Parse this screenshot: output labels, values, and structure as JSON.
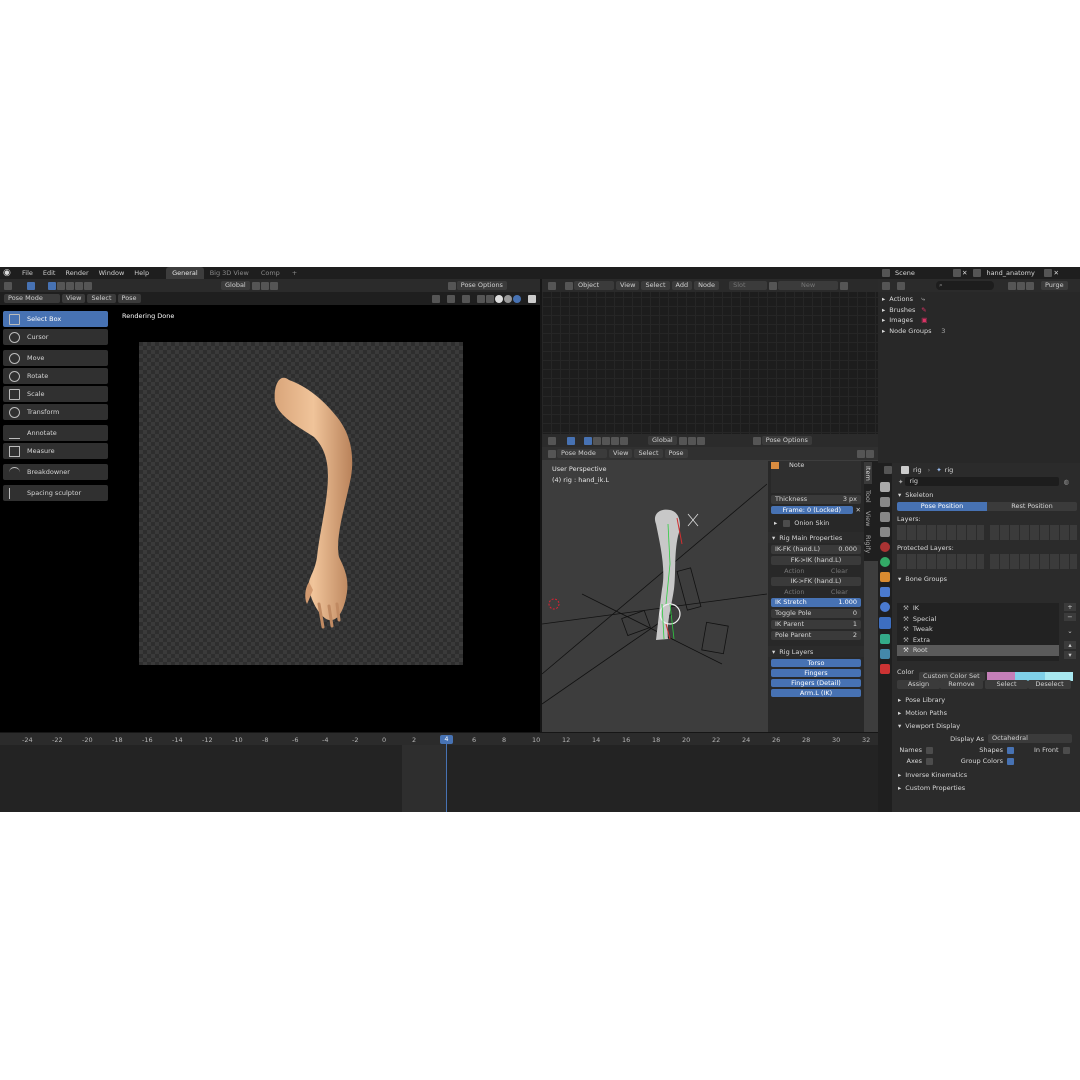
{
  "topbar": {
    "menus": [
      "File",
      "Edit",
      "Render",
      "Window",
      "Help"
    ],
    "workspaces": [
      {
        "label": "General",
        "active": true
      },
      {
        "label": "Big 3D View",
        "active": false
      },
      {
        "label": "Comp",
        "active": false
      }
    ],
    "add_tab": "+"
  },
  "left_viewport": {
    "mode": "Pose Mode",
    "menus": [
      "View",
      "Select",
      "Pose"
    ],
    "orientation": "Global",
    "pose_options": "Pose Options",
    "status": "Rendering Done",
    "tools": [
      "Select Box",
      "Cursor",
      "Move",
      "Rotate",
      "Scale",
      "Transform",
      "Annotate",
      "Measure",
      "Breakdowner",
      "Spacing sculptor"
    ]
  },
  "node_editor": {
    "mode": "Object",
    "menus": [
      "View",
      "Select",
      "Add",
      "Node"
    ],
    "slot": "Slot",
    "new_button": "New"
  },
  "small_viewport": {
    "orientation": "Global",
    "pose_options": "Pose Options",
    "mode": "Pose Mode",
    "menus": [
      "View",
      "Select",
      "Pose"
    ],
    "overlay_title": "User Perspective",
    "overlay_sub": "(4) rig : hand_ik.L",
    "side_tabs": [
      "Item",
      "Tool",
      "View",
      "Rigify"
    ]
  },
  "sidebar": {
    "note": "Note",
    "thickness_label": "Thickness",
    "thickness_value": "3 px",
    "frame_locked": "Frame: 0 (Locked)",
    "onion_skin": "Onion Skin",
    "rig_main_title": "Rig Main Properties",
    "ikfk_label": "IK-FK (hand.L)",
    "ikfk_value": "0.000",
    "fk_to_ik": "FK->IK (hand.L)",
    "ik_to_fk": "IK->FK (hand.L)",
    "action": "Action",
    "clear": "Clear",
    "ik_stretch_label": "IK Stretch",
    "ik_stretch_value": "1.000",
    "toggle_pole_label": "Toggle Pole",
    "toggle_pole_value": "0",
    "ik_parent_label": "IK Parent",
    "ik_parent_value": "1",
    "pole_parent_label": "Pole Parent",
    "pole_parent_value": "2",
    "rig_layers_title": "Rig Layers",
    "rig_layers": [
      "Torso",
      "Fingers",
      "Fingers (Detail)",
      "Arm.L (IK)"
    ]
  },
  "timeline": {
    "ticks": [
      "-24",
      "-22",
      "-20",
      "-18",
      "-16",
      "-14",
      "-12",
      "-10",
      "-8",
      "-6",
      "-4",
      "-2",
      "0",
      "2",
      "4",
      "6",
      "8",
      "10",
      "12",
      "14",
      "16",
      "18",
      "20",
      "22",
      "24",
      "26",
      "28",
      "30",
      "32"
    ],
    "current_frame": "4"
  },
  "outliner": {
    "scene": "Scene",
    "view_layer": "hand_anatomy",
    "purge": "Purge",
    "items": [
      "Actions",
      "Brushes",
      "Images",
      "Node Groups"
    ],
    "node_groups_count": "3"
  },
  "properties": {
    "object_name": "rig",
    "armature_name": "rig",
    "data_field": "rig",
    "skeleton_title": "Skeleton",
    "pose_position": "Pose Position",
    "rest_position": "Rest Position",
    "layers_label": "Layers:",
    "protected_layers_label": "Protected Layers:",
    "bone_groups_title": "Bone Groups",
    "bone_groups": [
      "IK",
      "Special",
      "Tweak",
      "Extra",
      "Root"
    ],
    "color_label": "Color ..",
    "color_set": "Custom Color Set",
    "assign": "Assign",
    "remove": "Remove",
    "select": "Select",
    "deselect": "Deselect",
    "pose_library": "Pose Library",
    "motion_paths": "Motion Paths",
    "viewport_display": "Viewport Display",
    "display_as_label": "Display As",
    "display_as_value": "Octahedral",
    "names": "Names",
    "shapes": "Shapes",
    "in_front": "In Front",
    "axes": "Axes",
    "group_colors": "Group Colors",
    "inverse_kinematics": "Inverse Kinematics",
    "custom_properties": "Custom Properties",
    "colors": {
      "accent": "#4772b3",
      "swatch1": "#c47fb8",
      "swatch2": "#7fd0e8",
      "swatch3": "#a8e8f0"
    }
  }
}
